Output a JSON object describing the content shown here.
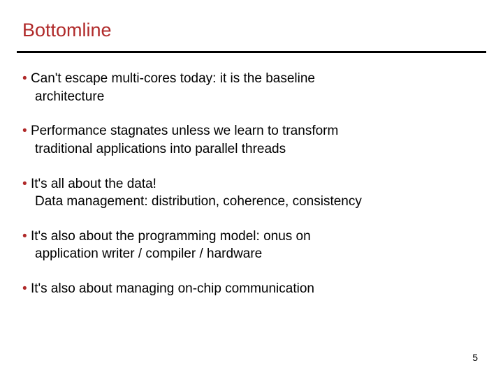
{
  "slide": {
    "title": "Bottomline",
    "bullets": [
      {
        "line1": "Can't escape multi-cores today: it is the baseline",
        "line2": "architecture"
      },
      {
        "line1": "Performance stagnates unless we learn to transform",
        "line2": "traditional applications into parallel threads"
      },
      {
        "line1": "It's all about the data!",
        "line2": "Data management: distribution, coherence, consistency"
      },
      {
        "line1": "It's also about the programming model: onus on",
        "line2": "application writer / compiler / hardware"
      },
      {
        "line1": "It's also about managing on-chip communication",
        "line2": ""
      }
    ],
    "page_number": "5"
  }
}
